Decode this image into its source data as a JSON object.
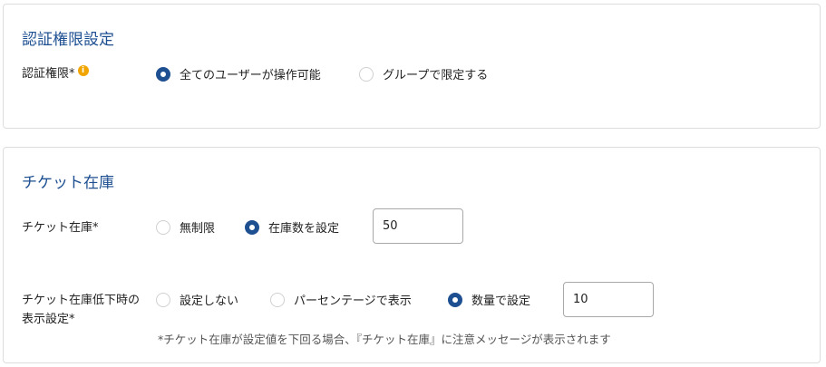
{
  "auth": {
    "title": "認証権限設定",
    "permission_label": "認証権限*",
    "info_icon": "i",
    "options": [
      {
        "label": "全てのユーザーが操作可能",
        "checked": true
      },
      {
        "label": "グループで限定する",
        "checked": false
      }
    ]
  },
  "stock": {
    "title": "チケット在庫",
    "stock_label": "チケット在庫*",
    "stock_options": [
      {
        "label": "無制限",
        "checked": false
      },
      {
        "label": "在庫数を設定",
        "checked": true
      }
    ],
    "stock_value": "50",
    "low_label_line1": "チケット在庫低下時の",
    "low_label_line2": "表示設定*",
    "low_options": [
      {
        "label": "設定しない",
        "checked": false
      },
      {
        "label": "パーセンテージで表示",
        "checked": false
      },
      {
        "label": "数量で設定",
        "checked": true
      }
    ],
    "low_value": "10",
    "note": "*チケット在庫が設定値を下回る場合、『チケット在庫』に注意メッセージが表示されます"
  },
  "colors": {
    "accent": "#1d4f91",
    "info": "#f0a500",
    "border": "#dddddd"
  }
}
